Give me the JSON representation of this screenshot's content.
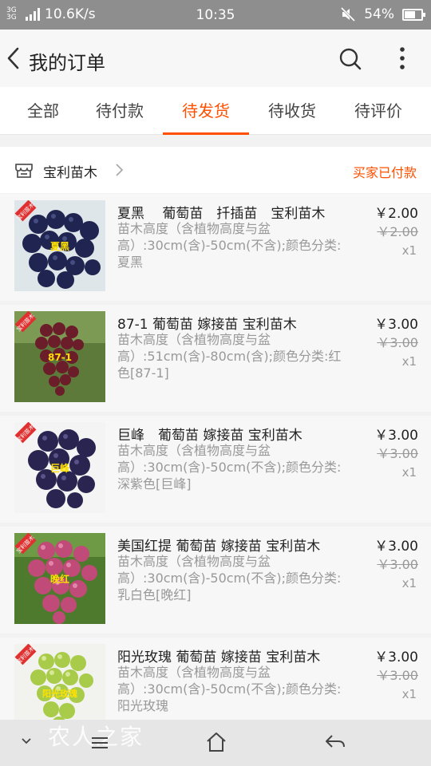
{
  "status_bar": {
    "signal_labels": "3G 3G",
    "net_speed": "10.6K/s",
    "time": "10:35",
    "battery": "54%"
  },
  "header": {
    "title": "我的订单"
  },
  "tabs": [
    {
      "label": "全部",
      "active": false
    },
    {
      "label": "待付款",
      "active": false
    },
    {
      "label": "待发货",
      "active": true
    },
    {
      "label": "待收货",
      "active": false
    },
    {
      "label": "待评价",
      "active": false
    }
  ],
  "shop": {
    "name": "宝利苗木",
    "status": "买家已付款"
  },
  "items": [
    {
      "title": "夏黑　 葡萄苗　扦插苗　宝利苗木",
      "desc": "苗木高度（含植物高度与盆高）:30cm(含)-50cm(不含);颜色分类:夏黑",
      "price": "￥2.00",
      "original_price": "￥2.00",
      "qty": "x1",
      "thumb_label": "夏黑",
      "thumb_stamp": "宝利苗木"
    },
    {
      "title": "87-1 葡萄苗 嫁接苗 宝利苗木",
      "desc": "苗木高度（含植物高度与盆高）:51cm(含)-80cm(含);颜色分类:红色[87-1]",
      "price": "￥3.00",
      "original_price": "￥3.00",
      "qty": "x1",
      "thumb_label": "87-1",
      "thumb_stamp": "宝利苗木"
    },
    {
      "title": "巨峰　葡萄苗 嫁接苗 宝利苗木",
      "desc": "苗木高度（含植物高度与盆高）:30cm(含)-50cm(不含);颜色分类:深紫色[巨峰]",
      "price": "￥3.00",
      "original_price": "￥3.00",
      "qty": "x1",
      "thumb_label": "巨峰",
      "thumb_stamp": "宝利苗木"
    },
    {
      "title": "美国红提 葡萄苗 嫁接苗 宝利苗木",
      "desc": "苗木高度（含植物高度与盆高）:30cm(含)-50cm(不含);颜色分类:乳白色[晚红]",
      "price": "￥3.00",
      "original_price": "￥3.00",
      "qty": "x1",
      "thumb_label": "晚红",
      "thumb_stamp": "宝利苗木"
    },
    {
      "title": "阳光玫瑰 葡萄苗 嫁接苗 宝利苗木",
      "desc": "苗木高度（含植物高度与盆高）:30cm(含)-50cm(不含);颜色分类:阳光玫瑰",
      "price": "￥3.00",
      "original_price": "￥3.00",
      "qty": "x1",
      "thumb_label": "阳光玫瑰",
      "thumb_stamp": "宝利苗木"
    }
  ],
  "watermark": "农人之家",
  "colors": {
    "accent": "#ff5000",
    "status_bar": "#8e8e8e"
  }
}
